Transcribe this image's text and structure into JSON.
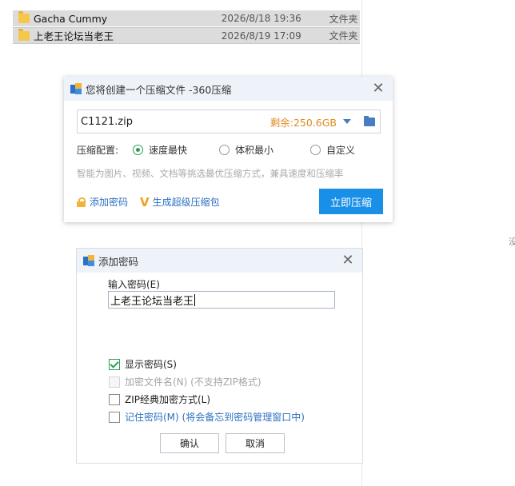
{
  "explorer": {
    "files": [
      {
        "name": "Gacha Cummy",
        "date": "2026/8/18 19:36",
        "type": "文件夹"
      },
      {
        "name": "上老王论坛当老王",
        "date": "2026/8/19 17:09",
        "type": "文件夹"
      }
    ],
    "edge_text": "没"
  },
  "compress_dialog": {
    "title": "您将创建一个压缩文件 -360压缩",
    "close_label": "✕",
    "path_value": "C1121.zip",
    "free_space": "剩余:250.6GB",
    "mode_label": "压缩配置:",
    "modes": [
      "速度最快",
      "体积最小",
      "自定义"
    ],
    "selected_mode": "速度最快",
    "hint": "智能为图片、视频、文档等挑选最优压缩方式，兼具速度和压缩率",
    "add_password_link": "添加密码",
    "super_compress_icon": "V",
    "super_compress_link": "生成超级压缩包",
    "compress_button": "立即压缩"
  },
  "password_dialog": {
    "title": "添加密码",
    "close_label": "✕",
    "input_label": "输入密码(E)",
    "password_value": "上老王论坛当老王",
    "options": [
      {
        "label": "显示密码(S)",
        "checked": true,
        "disabled": false
      },
      {
        "label": "加密文件名(N) (不支持ZIP格式)",
        "checked": false,
        "disabled": true
      },
      {
        "label": "ZIP经典加密方式(L)",
        "checked": false,
        "disabled": false
      },
      {
        "label": "记住密码(M) (将会备忘到密码管理窗口中)",
        "checked": false,
        "disabled": false
      }
    ],
    "ok_button": "确认",
    "cancel_button": "取消"
  },
  "colors": {
    "accent": "#1a8fe8",
    "link": "#2c6fc0",
    "free_space": "#e08a1e",
    "check_green": "#2e9d53"
  }
}
